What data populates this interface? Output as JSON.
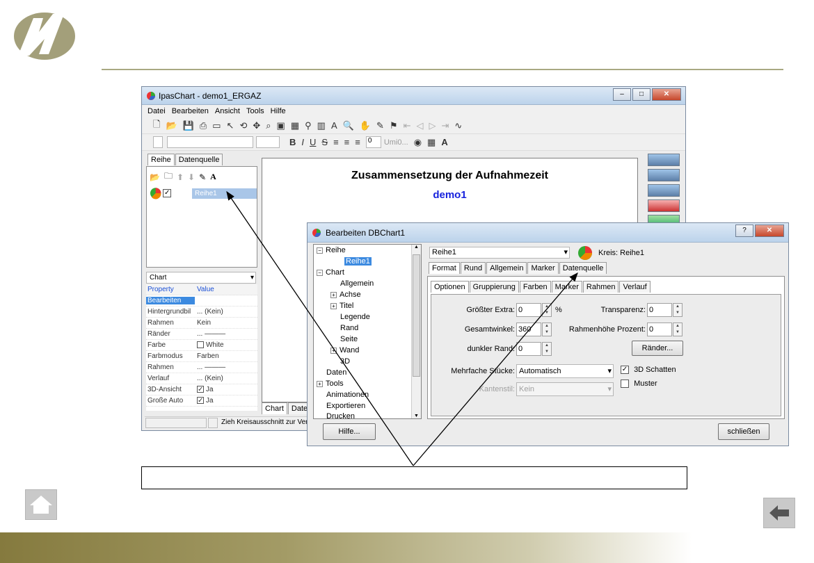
{
  "main_window": {
    "title": "IpasChart - demo1_ERGAZ",
    "menu": [
      "Datei",
      "Bearbeiten",
      "Ansicht",
      "Tools",
      "Hilfe"
    ],
    "format_toolbar": {
      "number_field": "0",
      "font_box": "Umi0..."
    },
    "left_tabs": [
      "Reihe",
      "Datenquelle"
    ],
    "series_item": "Reihe1",
    "property_combo": "Chart",
    "property_headers": [
      "Property",
      "Value"
    ],
    "properties": [
      {
        "name": "Bearbeiten",
        "value": ""
      },
      {
        "name": "Hintergrundbil",
        "value": "...  (Kein)"
      },
      {
        "name": "Rahmen",
        "value": "Kein"
      },
      {
        "name": "Ränder",
        "value": "...  ———"
      },
      {
        "name": "Farbe",
        "value": "White"
      },
      {
        "name": "Farbmodus",
        "value": "Farben"
      },
      {
        "name": "Rahmen",
        "value": "...  ———"
      },
      {
        "name": "Verlauf",
        "value": "...  (Kein)"
      },
      {
        "name": "3D-Ansicht",
        "value": "Ja"
      },
      {
        "name": "Große Auto",
        "value": "Ja"
      }
    ],
    "chart_title": "Zusammensetzung der Aufnahmezeit",
    "chart_subtitle": "demo1",
    "bottom_tabs": [
      "Chart",
      "Daten"
    ],
    "status_text": "Zieh Kreisausschnitt zur Ver"
  },
  "dialog": {
    "title": "Bearbeiten DBChart1",
    "tree": [
      {
        "label": "Reihe",
        "expander": "−"
      },
      {
        "label": "Reihe1",
        "selected": true
      },
      {
        "label": "Chart",
        "expander": "−"
      },
      {
        "label": "Allgemein"
      },
      {
        "label": "Achse",
        "expander": "+"
      },
      {
        "label": "Titel",
        "expander": "+"
      },
      {
        "label": "Legende"
      },
      {
        "label": "Rand"
      },
      {
        "label": "Seite"
      },
      {
        "label": "Wand",
        "expander": "+"
      },
      {
        "label": "3D"
      },
      {
        "label": "Daten"
      },
      {
        "label": "Tools",
        "expander": "+"
      },
      {
        "label": "Animationen"
      },
      {
        "label": "Exportieren"
      },
      {
        "label": "Drucken"
      }
    ],
    "series_select": "Reihe1",
    "series_type": "Kreis: Reihe1",
    "tabs": [
      "Format",
      "Rund",
      "Allgemein",
      "Marker",
      "Datenquelle"
    ],
    "subtabs": [
      "Optionen",
      "Gruppierung",
      "Farben",
      "Marker",
      "Rahmen",
      "Verlauf"
    ],
    "fields": {
      "groesster_extra": {
        "label": "Größter Extra:",
        "value": "0",
        "unit": "%"
      },
      "transparenz": {
        "label": "Transparenz:",
        "value": "0"
      },
      "gesamtwinkel": {
        "label": "Gesamtwinkel:",
        "value": "360"
      },
      "rahmenhoehe": {
        "label": "Rahmenhöhe Prozent:",
        "value": "0"
      },
      "dunkler_rand": {
        "label": "dunkler Rand:",
        "value": "0"
      },
      "raender_button": "Ränder...",
      "mehrfache": {
        "label": "Mehrfache Stücke:",
        "value": "Automatisch"
      },
      "schatten": {
        "label": "3D Schatten",
        "checked": true
      },
      "kantenstil": {
        "label": "Kantenstil:",
        "value": "Kein"
      },
      "muster": {
        "label": "Muster",
        "checked": false
      }
    },
    "help_button": "Hilfe...",
    "close_button": "schließen"
  }
}
